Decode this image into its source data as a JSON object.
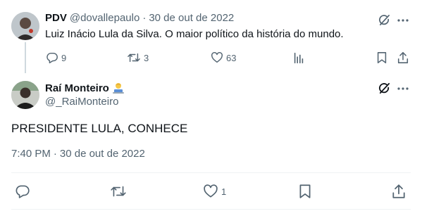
{
  "parent_tweet": {
    "name": "PDV",
    "handle": "@dovallepaulo",
    "separator": "·",
    "date": "30 de out de 2022",
    "text": "Luiz Inácio Lula da Silva. O maior político da história do mundo.",
    "replies": "9",
    "retweets": "3",
    "likes": "63"
  },
  "main_tweet": {
    "name": "Raí Monteiro",
    "handle": "@_RaiMonteiro",
    "text": "PRESIDENTE LULA, CONHECE",
    "time": "7:40 PM",
    "separator": "·",
    "date": "30 de out de 2022",
    "likes": "1"
  },
  "colors": {
    "text": "#0f1419",
    "muted": "#536471",
    "thread_line": "#cfd9de",
    "divider": "#eff3f4"
  },
  "icons": {
    "grok": "grok-icon",
    "more": "more-dots-icon",
    "reply": "reply-icon",
    "retweet": "retweet-icon",
    "like": "heart-icon",
    "views": "views-icon",
    "bookmark": "bookmark-icon",
    "share": "share-icon",
    "badge": "technologist-emoji-icon"
  }
}
